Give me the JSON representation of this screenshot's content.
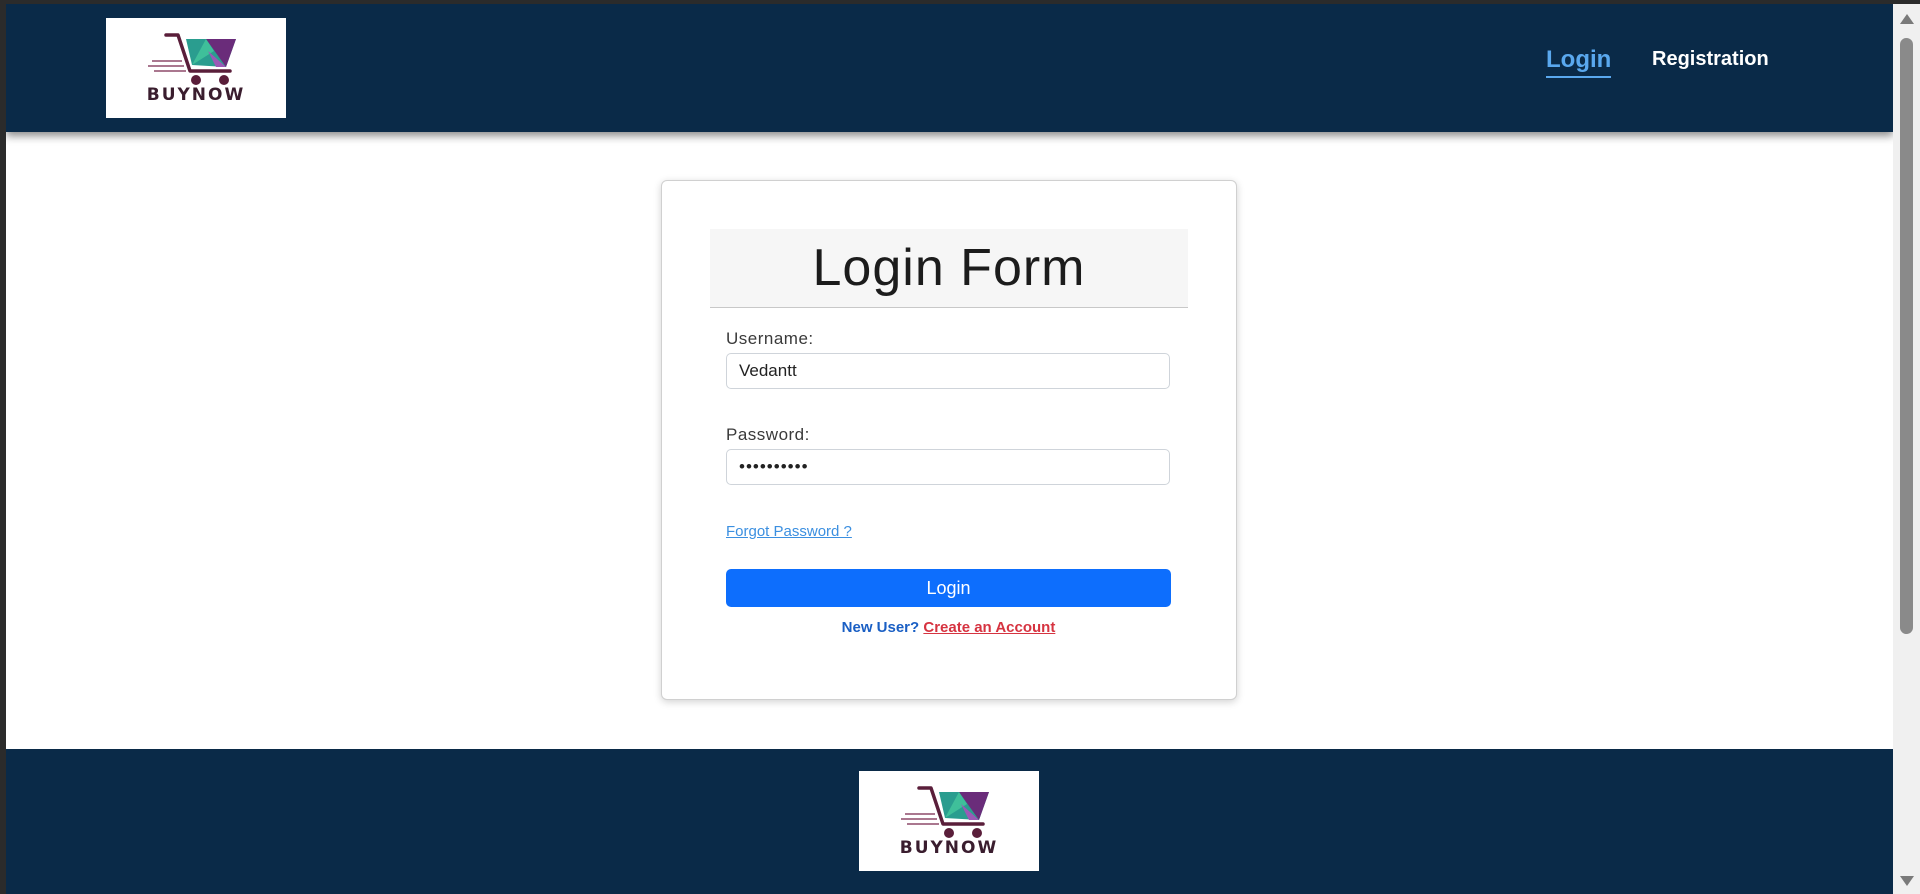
{
  "header": {
    "logo_text": "BUYNOW",
    "nav": {
      "login_label": "Login",
      "registration_label": "Registration"
    }
  },
  "form": {
    "title": "Login Form",
    "username_label": "Username:",
    "username_value": "Vedantt",
    "password_label": "Password:",
    "password_value": "••••••••••",
    "forgot_label": "Forgot Password ?",
    "login_button_label": "Login",
    "new_user_label": "New User?",
    "create_account_label": "Create an Account"
  },
  "footer": {
    "logo_text": "BUYNOW"
  },
  "colors": {
    "navbar": "#0a2a48",
    "active_link": "#5aa8ee",
    "primary_button": "#0d6efd",
    "create_link": "#d63340",
    "new_user": "#1a5fc4"
  },
  "icons": {
    "logo": "shopping-cart-logo-icon",
    "scroll_up": "chevron-up-icon",
    "scroll_down": "chevron-down-icon"
  }
}
